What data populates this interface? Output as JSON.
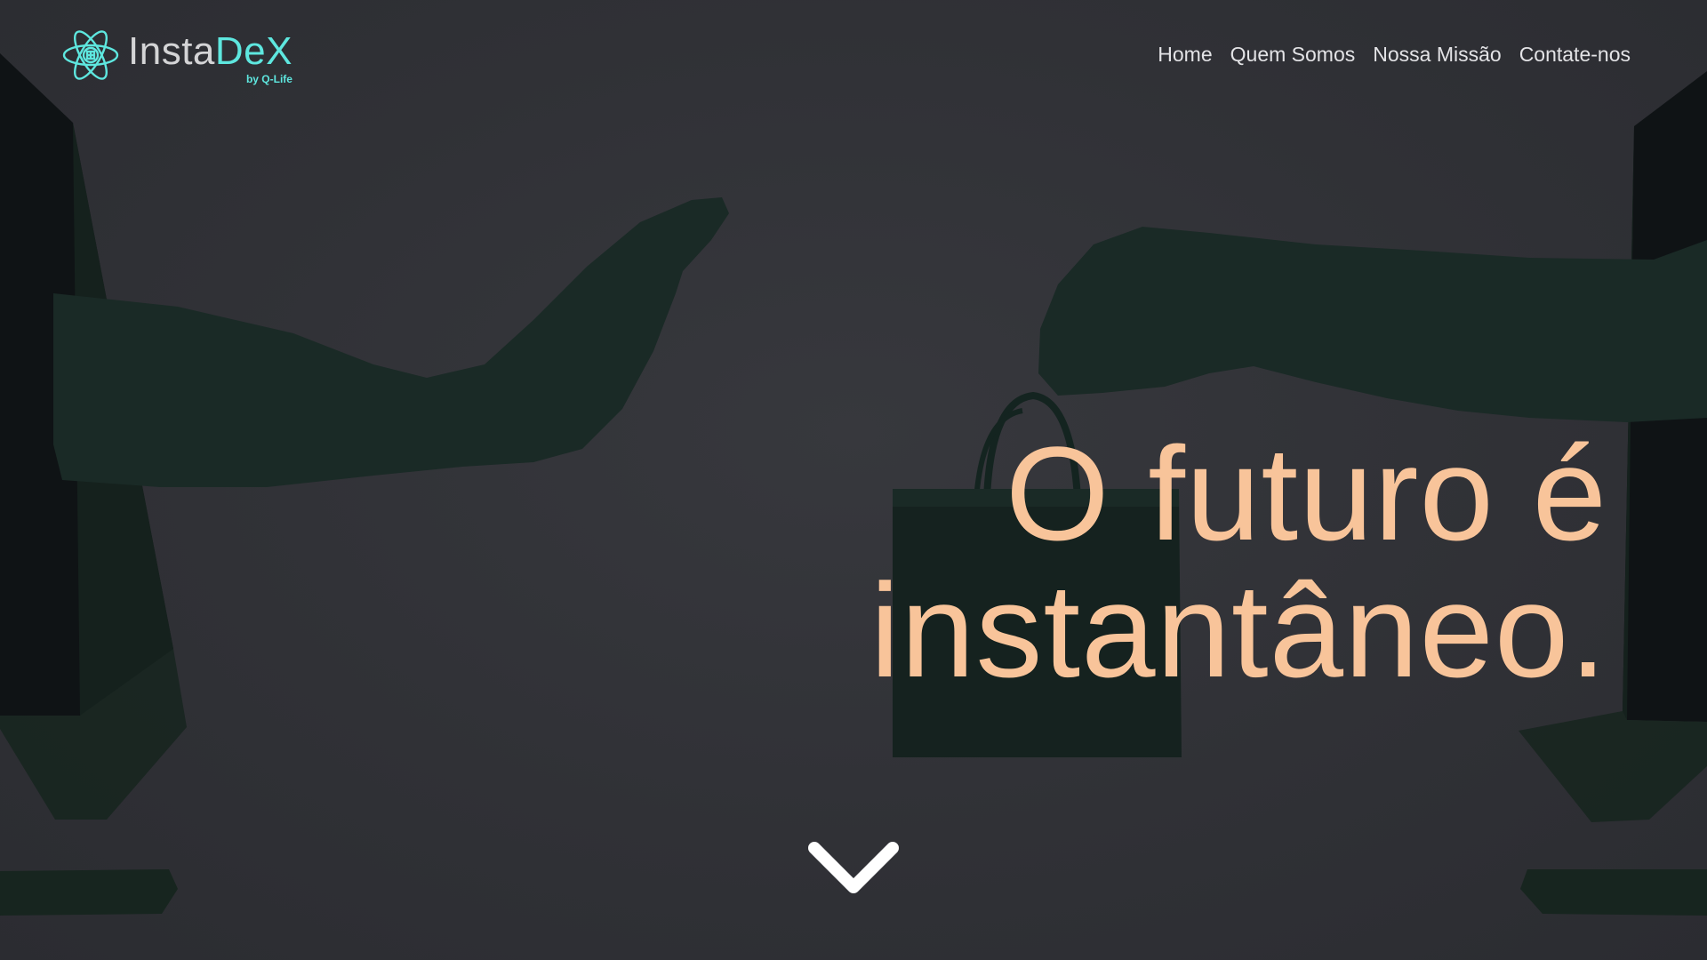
{
  "brand": {
    "name_part1": "Insta",
    "name_part2": "DeX",
    "tagline": "by Q-Life",
    "accent_color": "#5ee7df",
    "logo_icon": "atom-icon"
  },
  "nav": {
    "items": [
      {
        "label": "Home"
      },
      {
        "label": "Quem Somos"
      },
      {
        "label": "Nossa Missão"
      },
      {
        "label": "Contate-nos"
      }
    ]
  },
  "hero": {
    "headline_line1": "O futuro é",
    "headline_line2": "instantâneo.",
    "headline_color": "#f8c49a",
    "scroll_icon": "chevron-down-icon"
  }
}
